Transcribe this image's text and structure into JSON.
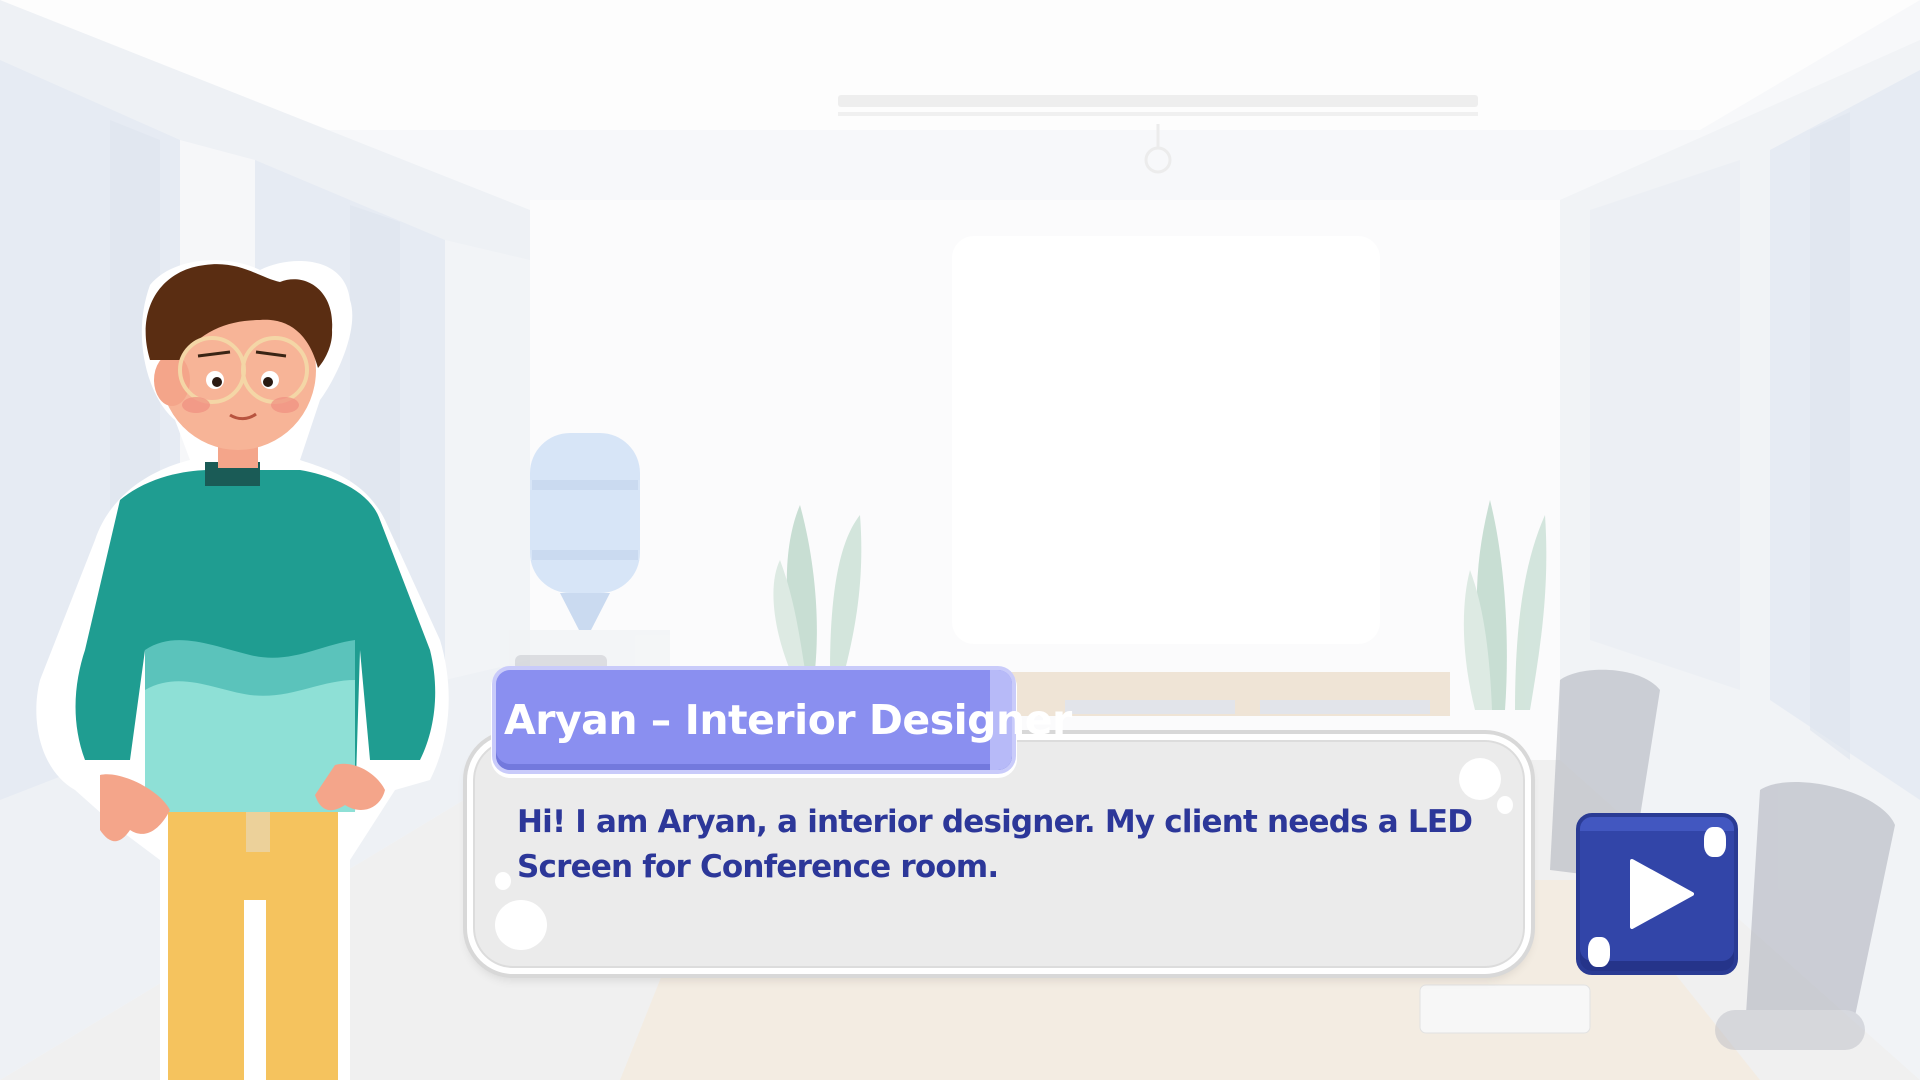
{
  "dialogue": {
    "speaker": "Aryan – Interior Designer",
    "text": "Hi! I am Aryan, a interior designer. My client needs a LED Screen for Conference room."
  },
  "controls": {
    "next_icon": "play-icon"
  },
  "colors": {
    "speaker_tab": "#8a8ff0",
    "dialog_text": "#2c3799",
    "next_button": "#3245a8",
    "dialog_bg": "#ebebeb"
  }
}
